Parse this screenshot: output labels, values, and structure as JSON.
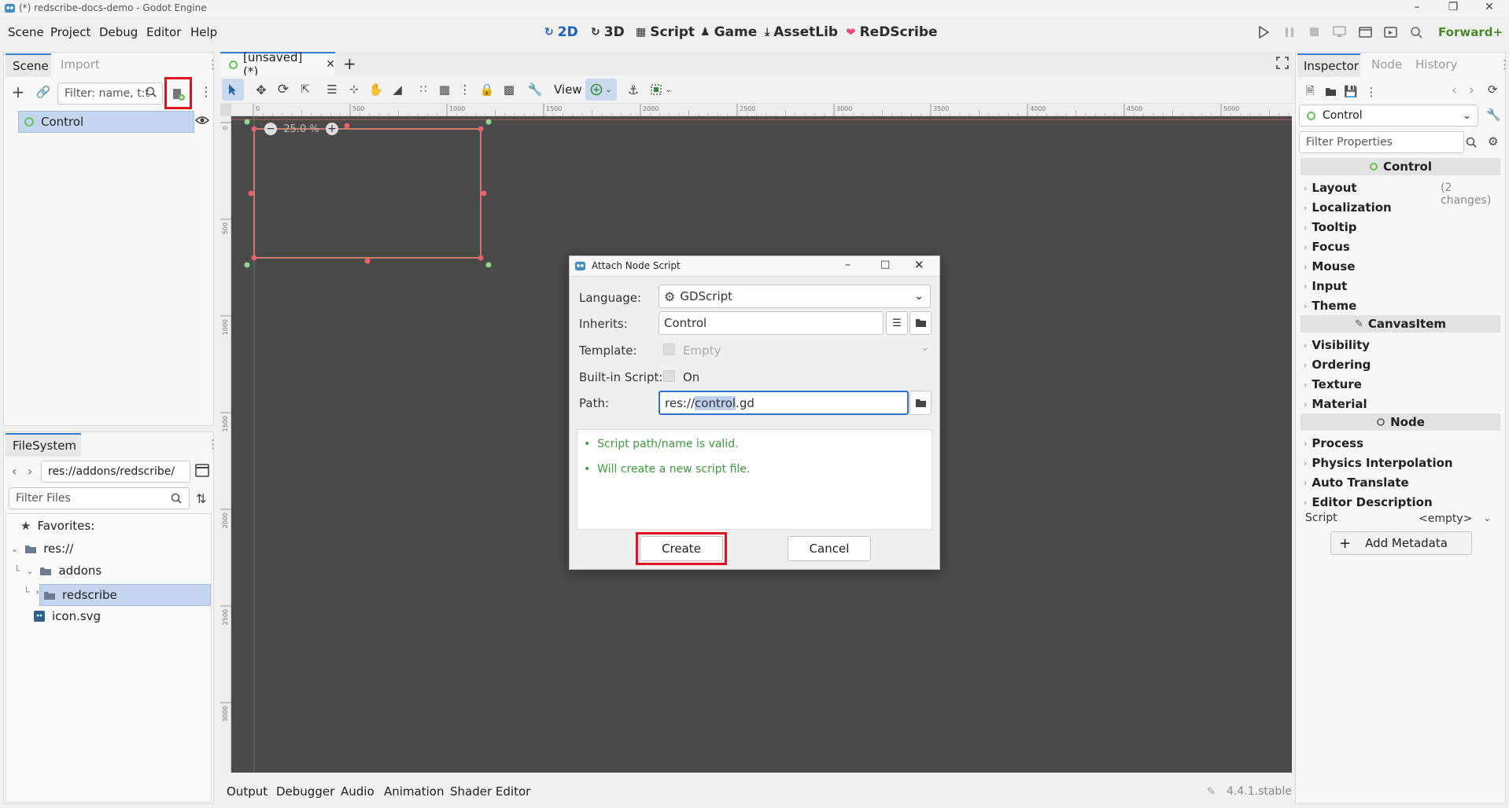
{
  "window": {
    "title": "(*) redscribe-docs-demo - Godot Engine"
  },
  "menu": [
    "Scene",
    "Project",
    "Debug",
    "Editor",
    "Help"
  ],
  "workspaces": [
    {
      "label": "2D",
      "icon": "2d-icon",
      "active": true
    },
    {
      "label": "3D",
      "icon": "3d-icon",
      "active": false
    },
    {
      "label": "Script",
      "icon": "script-icon",
      "active": false
    },
    {
      "label": "Game",
      "icon": "game-icon",
      "active": false
    },
    {
      "label": "AssetLib",
      "icon": "assetlib-icon",
      "active": false
    },
    {
      "label": "ReDScribe",
      "icon": "heart-icon",
      "active": false
    }
  ],
  "renderer": "Forward+",
  "scene_dock": {
    "tabs": [
      "Scene",
      "Import"
    ],
    "filter_placeholder": "Filter: name, t:t",
    "root_node": "Control"
  },
  "filesystem_dock": {
    "title": "FileSystem",
    "path": "res://addons/redscribe/",
    "filter_placeholder": "Filter Files",
    "tree": {
      "favorites": "Favorites:",
      "root": "res://",
      "addons": "addons",
      "redscribe": "redscribe",
      "icon_file": "icon.svg"
    }
  },
  "editor_tabs": {
    "scene_tab": "[unsaved](*)"
  },
  "toolbar": {
    "view_label": "View"
  },
  "viewport": {
    "zoom": "25.0 %",
    "ruler_labels": [
      "0",
      "500",
      "1000",
      "1500",
      "2000",
      "2500",
      "3000",
      "3500",
      "4000",
      "4500",
      "5000"
    ],
    "vruler_labels": [
      "0",
      "500",
      "1000",
      "1500",
      "2000",
      "2500",
      "3000"
    ]
  },
  "dialog": {
    "title": "Attach Node Script",
    "language_label": "Language:",
    "language_value": "GDScript",
    "inherits_label": "Inherits:",
    "inherits_value": "Control",
    "template_label": "Template:",
    "template_value": "Empty",
    "builtin_label": "Built-in Script:",
    "builtin_value": "On",
    "path_label": "Path:",
    "path_prefix": "res://",
    "path_selected": "control",
    "path_suffix": ".gd",
    "messages": [
      "Script path/name is valid.",
      "Will create a new script file."
    ],
    "create_label": "Create",
    "cancel_label": "Cancel"
  },
  "inspector": {
    "tabs": [
      "Inspector",
      "Node",
      "History"
    ],
    "node_selector": "Control",
    "filter_placeholder": "Filter Properties",
    "section_control": "Control",
    "control_items": [
      {
        "label": "Layout",
        "note": "(2 changes)"
      },
      {
        "label": "Localization",
        "note": ""
      },
      {
        "label": "Tooltip",
        "note": ""
      },
      {
        "label": "Focus",
        "note": ""
      },
      {
        "label": "Mouse",
        "note": ""
      },
      {
        "label": "Input",
        "note": ""
      },
      {
        "label": "Theme",
        "note": ""
      }
    ],
    "section_canvasitem": "CanvasItem",
    "canvas_items": [
      "Visibility",
      "Ordering",
      "Texture",
      "Material"
    ],
    "section_node": "Node",
    "node_items": [
      "Process",
      "Physics Interpolation",
      "Auto Translate",
      "Editor Description"
    ],
    "script_label": "Script",
    "script_value": "<empty>",
    "add_metadata": "Add Metadata"
  },
  "bottom_panel": {
    "tabs": [
      "Output",
      "Debugger",
      "Audio",
      "Animation",
      "Shader Editor"
    ],
    "version": "4.4.1.stable"
  },
  "colors": {
    "accent": "#2f7bd6",
    "highlight_red": "#e0141e",
    "valid_green": "#3c9a3c",
    "viewport_bg": "#4a4a4a",
    "selection_orange": "#e8886f"
  }
}
